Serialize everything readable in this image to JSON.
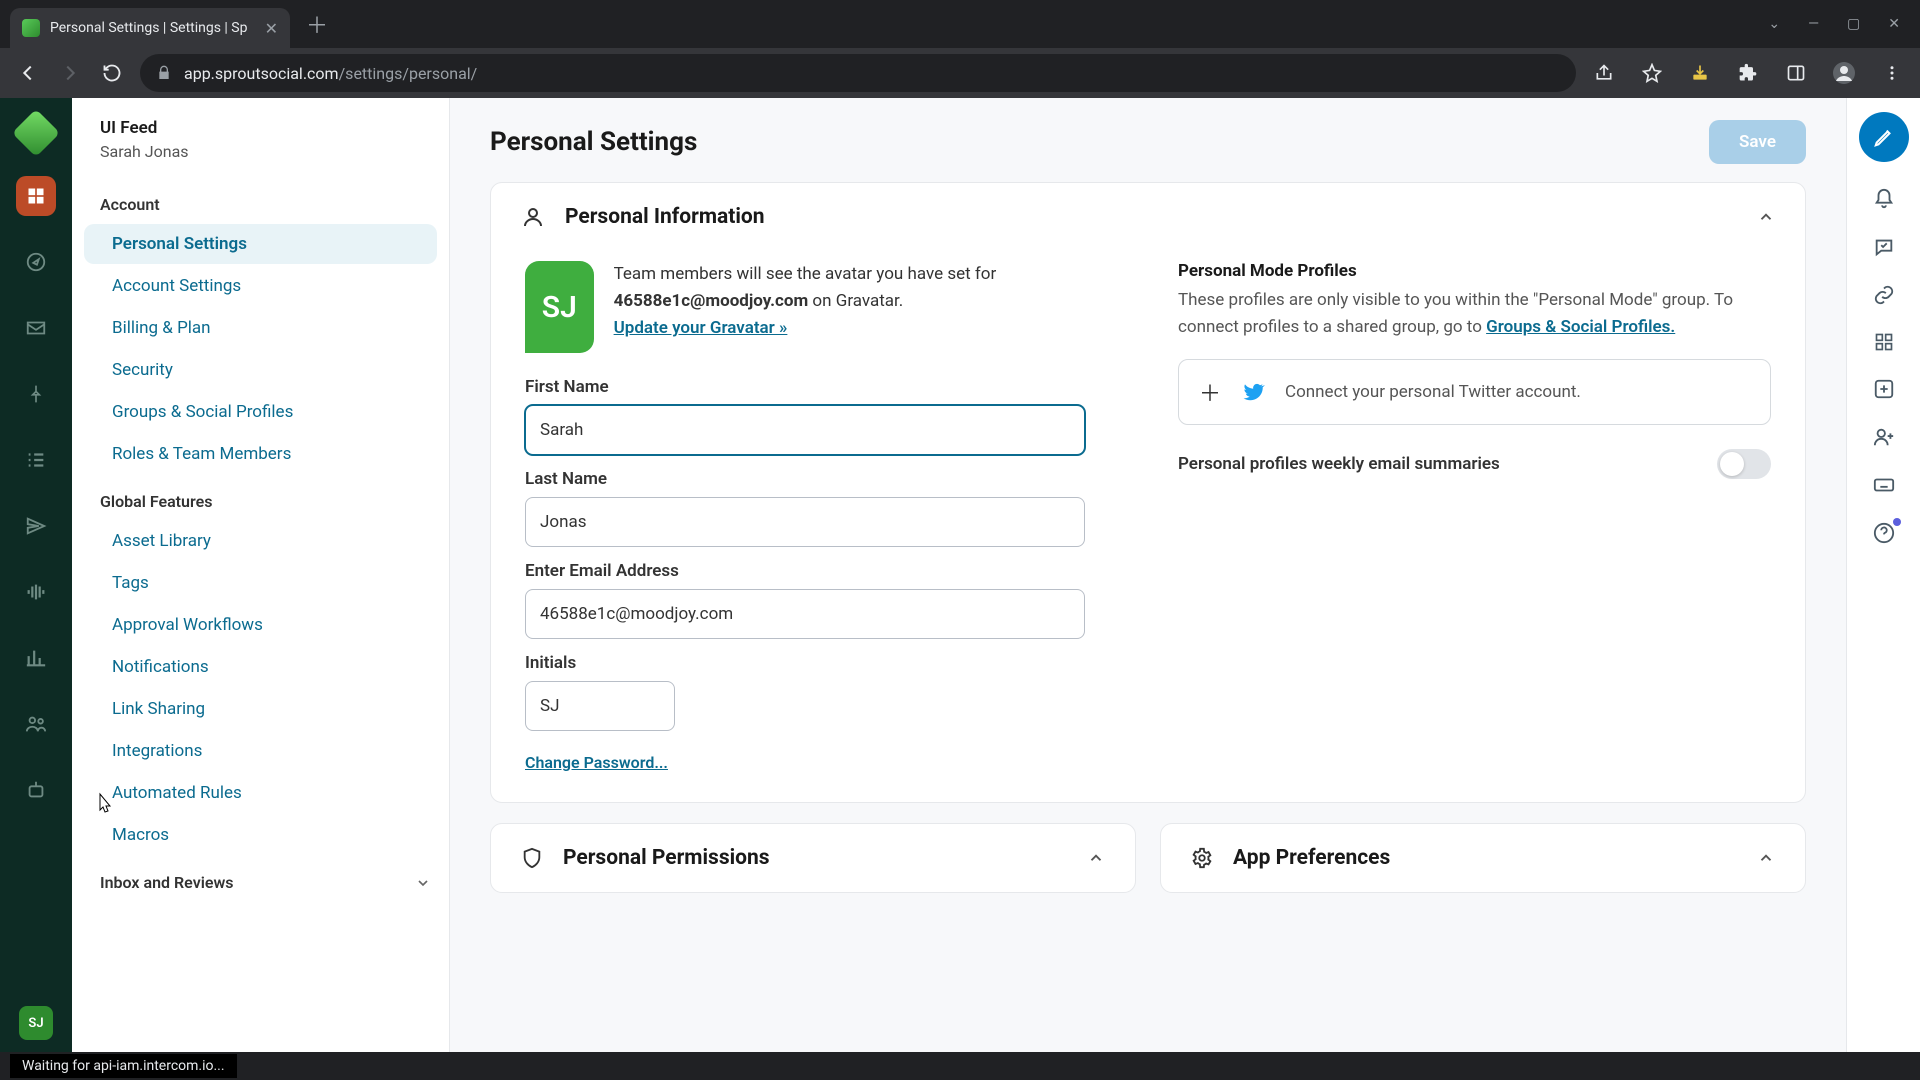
{
  "browser": {
    "tab_title": "Personal Settings | Settings | Sp",
    "url_domain": "app.sproutsocial.com",
    "url_path": "/settings/personal/"
  },
  "subnav": {
    "org": "UI Feed",
    "user": "Sarah Jonas",
    "sections": {
      "account": {
        "label": "Account",
        "items": [
          "Personal Settings",
          "Account Settings",
          "Billing & Plan",
          "Security",
          "Groups & Social Profiles",
          "Roles & Team Members"
        ]
      },
      "global": {
        "label": "Global Features",
        "items": [
          "Asset Library",
          "Tags",
          "Approval Workflows",
          "Notifications",
          "Link Sharing",
          "Integrations",
          "Automated Rules",
          "Macros"
        ]
      },
      "inbox": {
        "label": "Inbox and Reviews"
      }
    }
  },
  "page": {
    "title": "Personal Settings",
    "save": "Save"
  },
  "personal_info": {
    "header": "Personal Information",
    "avatar_initials": "SJ",
    "avatar_line1": "Team members will see the avatar you have set for ",
    "avatar_email": "46588e1c@moodjoy.com",
    "avatar_line2": " on Gravatar.",
    "update_gravatar": "Update your Gravatar »",
    "first_name_label": "First Name",
    "first_name": "Sarah",
    "last_name_label": "Last Name",
    "last_name": "Jonas",
    "email_label": "Enter Email Address",
    "email": "46588e1c@moodjoy.com",
    "initials_label": "Initials",
    "initials": "SJ",
    "change_password": "Change Password...",
    "pmp_heading": "Personal Mode Profiles",
    "pmp_text1": "These profiles are only visible to you within the \"Personal Mode\" group. To connect profiles to a shared group, go to ",
    "pmp_link": "Groups & Social Profiles.",
    "connect_twitter": "Connect your personal Twitter account.",
    "weekly_summaries": "Personal profiles weekly email summaries"
  },
  "lower_cards": {
    "permissions": "Personal Permissions",
    "preferences": "App Preferences"
  },
  "rail_avatar": "SJ",
  "status": "Waiting for api-iam.intercom.io..."
}
